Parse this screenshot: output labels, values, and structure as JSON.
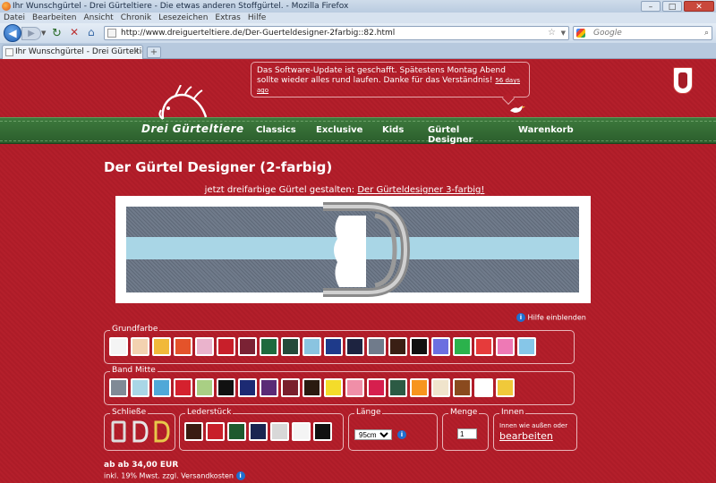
{
  "browser": {
    "window_title": "Ihr Wunschgürtel - Drei Gürteltiere - Die etwas anderen Stoffgürtel. - Mozilla Firefox",
    "menu": [
      "Datei",
      "Bearbeiten",
      "Ansicht",
      "Chronik",
      "Lesezeichen",
      "Extras",
      "Hilfe"
    ],
    "url": "http://www.dreiguerteltiere.de/Der-Guerteldesigner-2farbig::82.html",
    "search_placeholder": "Google",
    "tab_title": "Ihr Wunschgürtel - Drei Gürteltiere -...",
    "new_tab": "+"
  },
  "notice": {
    "text": "Das Software-Update ist geschafft. Spätestens Montag Abend sollte wieder alles rund laufen. Danke für das Verständnis!",
    "link": "56 days ago"
  },
  "logo": {
    "text": "Drei Gürteltiere"
  },
  "nav": [
    "Classics",
    "Exclusive",
    "Kids",
    "Gürtel Designer",
    "Warenkorb"
  ],
  "page": {
    "title": "Der Gürtel Designer (2-farbig)",
    "promo_text": "jetzt dreifarbige Gürtel gestalten: ",
    "promo_link": "Der Gürteldesigner 3-farbig!",
    "help_link": "Hilfe einblenden"
  },
  "grundfarbe": {
    "legend": "Grundfarbe",
    "colors": [
      "#f4f4f4",
      "#f3d2b0",
      "#f1b93a",
      "#e4532a",
      "#eab3cc",
      "#c81f2a",
      "#7a2234",
      "#1e6a3e",
      "#244a3a",
      "#8ac4e0",
      "#1e3a8a",
      "#1d2340",
      "#707b8b",
      "#3a1f14",
      "#111111",
      "#6b6fe0",
      "#2bb24c",
      "#e63b3b",
      "#ee79b5",
      "#86c6e8"
    ]
  },
  "bandmitte": {
    "legend": "Band Mitte",
    "colors": [
      "#808a96",
      "#a9d6e6",
      "#4fa8d8",
      "#d5212e",
      "#a9cf84",
      "#111111",
      "#1c2a73",
      "#5a2a76",
      "#7a1f2c",
      "#2a1a10",
      "#f4dc2a",
      "#f08fa8",
      "#d61f4e",
      "#2c5a44",
      "#f7951e",
      "#f0e4cc",
      "#8a4a1e",
      "#ffffff",
      "#f0c93a"
    ]
  },
  "schliesse": {
    "legend": "Schließe"
  },
  "lederstueck": {
    "legend": "Lederstück",
    "colors": [
      "#3a1c12",
      "#c81f2a",
      "#1e5a2e",
      "#1a2450",
      "#d8d8d8",
      "#f4f4f4",
      "#111111"
    ]
  },
  "laenge": {
    "legend": "Länge",
    "value": "95cm"
  },
  "menge": {
    "legend": "Menge",
    "value": "1"
  },
  "innen": {
    "legend": "Innen",
    "text": "Innen wie außen oder",
    "link": "bearbeiten"
  },
  "price": {
    "main": "ab ab 34,00 EUR",
    "note": "inkl. 19% Mwst. zzgl. Versandkosten"
  }
}
